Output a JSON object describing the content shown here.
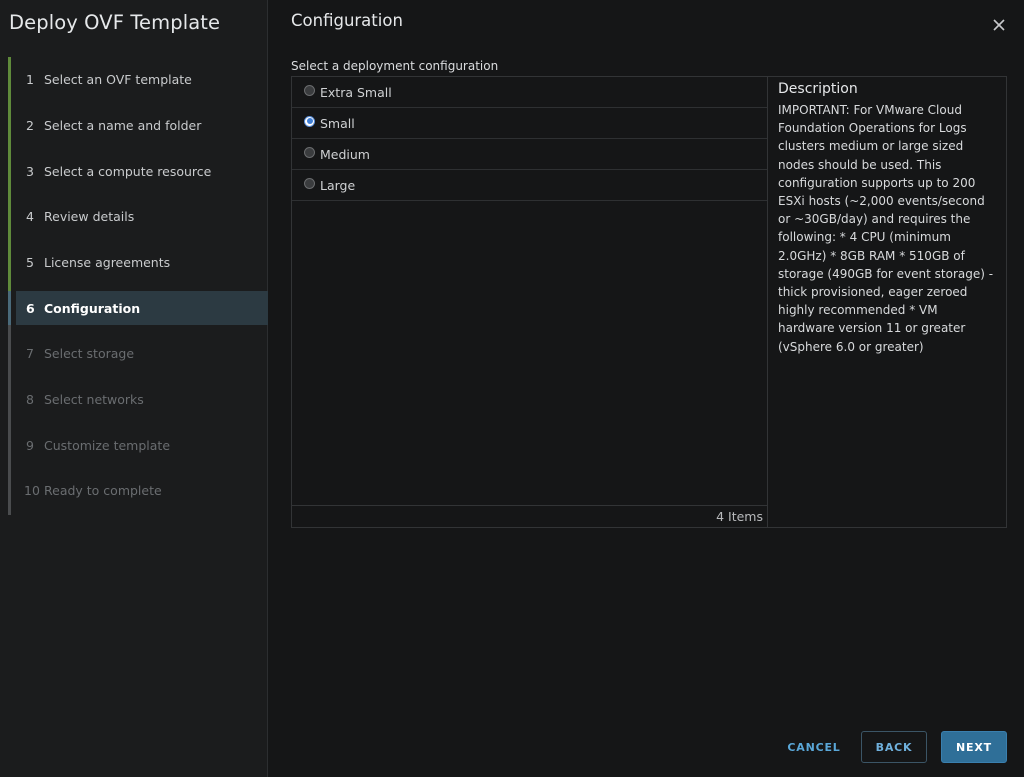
{
  "sidebar": {
    "title": "Deploy OVF Template",
    "steps": [
      {
        "num": "1",
        "label": "Select an OVF template"
      },
      {
        "num": "2",
        "label": "Select a name and folder"
      },
      {
        "num": "3",
        "label": "Select a compute resource"
      },
      {
        "num": "4",
        "label": "Review details"
      },
      {
        "num": "5",
        "label": "License agreements"
      },
      {
        "num": "6",
        "label": "Configuration"
      },
      {
        "num": "7",
        "label": "Select storage"
      },
      {
        "num": "8",
        "label": "Select networks"
      },
      {
        "num": "9",
        "label": "Customize template"
      },
      {
        "num": "10",
        "label": "Ready to complete"
      }
    ]
  },
  "main": {
    "title": "Configuration",
    "section_label": "Select a deployment configuration",
    "options": [
      {
        "label": "Extra Small",
        "selected": false
      },
      {
        "label": "Small",
        "selected": true
      },
      {
        "label": "Medium",
        "selected": false
      },
      {
        "label": "Large",
        "selected": false
      }
    ],
    "footer": "4 Items",
    "description": {
      "title": "Description",
      "body": "IMPORTANT: For VMware Cloud Foundation Operations for Logs clusters medium or large sized nodes should be used. This configuration supports up to 200 ESXi hosts (~2,000 events/second or ~30GB/day) and requires the following: * 4 CPU (minimum 2.0GHz) * 8GB RAM * 510GB of storage (490GB for event storage) - thick provisioned, eager zeroed highly recommended * VM hardware version 11 or greater (vSphere 6.0 or greater)"
    }
  },
  "buttons": {
    "cancel": "CANCEL",
    "back": "BACK",
    "next": "NEXT"
  },
  "icons": {
    "close": "close-icon"
  },
  "colors": {
    "step_done": "#5f8a3b",
    "step_active_bg": "#2c3a42",
    "primary": "#2f6f98",
    "link": "#5aa7d8"
  }
}
